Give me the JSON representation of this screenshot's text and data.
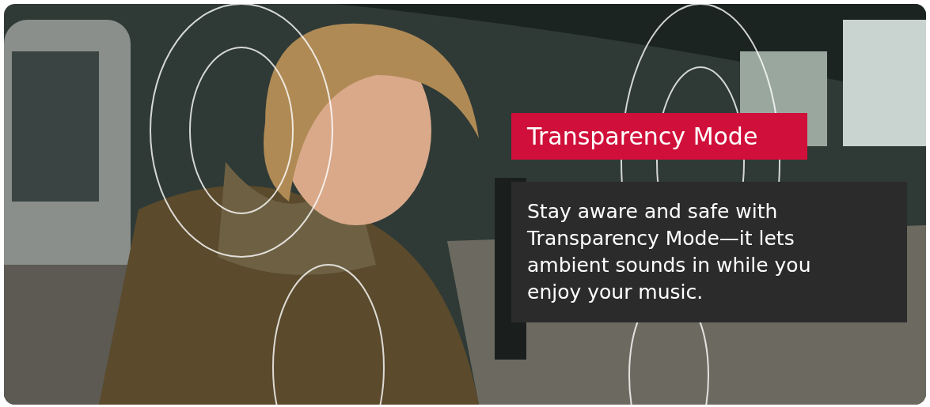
{
  "banner": {
    "title": "Transparency Mode",
    "description": "Stay aware and safe with Transparency Mode—it lets ambient sounds in while you enjoy your music."
  }
}
